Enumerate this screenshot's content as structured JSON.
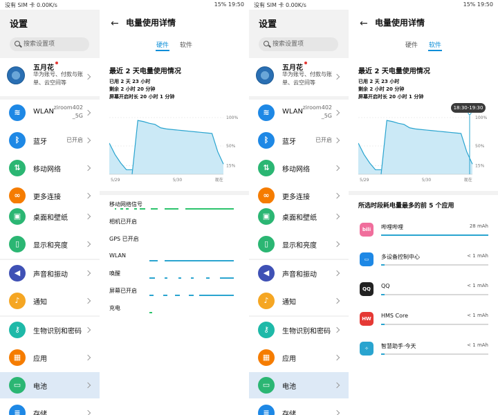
{
  "status_bar": {
    "left": "没有 SIM 卡 0.00K/s",
    "right": "15% 19:50"
  },
  "settings": {
    "title": "设置",
    "search_placeholder": "搜索设置项",
    "account": {
      "name": "五月花",
      "desc": "华为账号、付款与账单、云空间等"
    },
    "items": [
      {
        "label": "WLAN",
        "value": "ziroom402\n_5G",
        "icon": "wifi-icon",
        "color": "#1e88e5"
      },
      {
        "label": "蓝牙",
        "value": "已开启",
        "icon": "bluetooth-icon",
        "color": "#1e88e5"
      },
      {
        "label": "移动网络",
        "value": "",
        "icon": "mobile-network-icon",
        "color": "#2bb673"
      },
      {
        "label": "更多连接",
        "value": "",
        "icon": "link-icon",
        "color": "#f57c00"
      },
      {
        "label": "桌面和壁纸",
        "value": "",
        "icon": "wallpaper-icon",
        "color": "#2bb673"
      },
      {
        "label": "显示和亮度",
        "value": "",
        "icon": "display-icon",
        "color": "#2bb673"
      },
      {
        "label": "声音和振动",
        "value": "",
        "icon": "sound-icon",
        "color": "#3f51b5"
      },
      {
        "label": "通知",
        "value": "",
        "icon": "bell-icon",
        "color": "#f5a623"
      },
      {
        "label": "生物识别和密码",
        "value": "",
        "icon": "key-icon",
        "color": "#1eb9a8"
      },
      {
        "label": "应用",
        "value": "",
        "icon": "apps-icon",
        "color": "#f57c00"
      },
      {
        "label": "电池",
        "value": "",
        "icon": "battery-icon",
        "color": "#2bb673"
      },
      {
        "label": "存储",
        "value": "",
        "icon": "storage-icon",
        "color": "#1e88e5"
      }
    ]
  },
  "detail": {
    "title": "电量使用详情",
    "tabs": [
      "硬件",
      "软件"
    ],
    "section": "最近 2 天电量使用情况",
    "used": "已用 2 天 23 小时",
    "remaining": "剩余 2 小时 20 分钟",
    "screen_on": "屏幕开启时长 20 小时 1 分钟",
    "y_ticks": [
      "100%",
      "50%",
      "15%"
    ],
    "x_ticks": [
      "5/29",
      "5/30",
      "现在"
    ],
    "hardware_rows": [
      "移动网络信号",
      "相机已开启",
      "GPS 已开启",
      "WLAN",
      "唤醒",
      "屏幕已开启",
      "充电"
    ],
    "tooltip": "18:30-19:30",
    "apps_title": "所选时段耗电量最多的前 5 个应用",
    "apps": [
      {
        "name": "哔哩哔哩",
        "value": "28 mAh",
        "share": 1.0,
        "icon": "bilibili-icon",
        "color": "#f06e9c"
      },
      {
        "name": "多设备控制中心",
        "value": "< 1 mAh",
        "share": 0.03,
        "icon": "multi-device-icon",
        "color": "#1e88e5"
      },
      {
        "name": "QQ",
        "value": "< 1 mAh",
        "share": 0.03,
        "icon": "qq-icon",
        "color": "#222222"
      },
      {
        "name": "HMS Core",
        "value": "< 1 mAh",
        "share": 0.03,
        "icon": "hms-core-icon",
        "color": "#e53935"
      },
      {
        "name": "智慧助手·今天",
        "value": "< 1 mAh",
        "share": 0.03,
        "icon": "smart-assistant-icon",
        "color": "#29a4cf"
      }
    ]
  },
  "chart_data": {
    "type": "area",
    "title": "",
    "ylabel": "",
    "xlabel": "",
    "ylim": [
      0,
      100
    ],
    "x_ticks": [
      "5/29",
      "5/30",
      "现在"
    ],
    "series": [
      {
        "values": [
          55,
          35,
          20,
          8,
          8,
          95,
          93,
          90,
          88,
          82,
          80,
          79,
          78,
          77,
          76,
          75,
          74,
          73,
          72,
          40,
          18
        ]
      }
    ]
  }
}
